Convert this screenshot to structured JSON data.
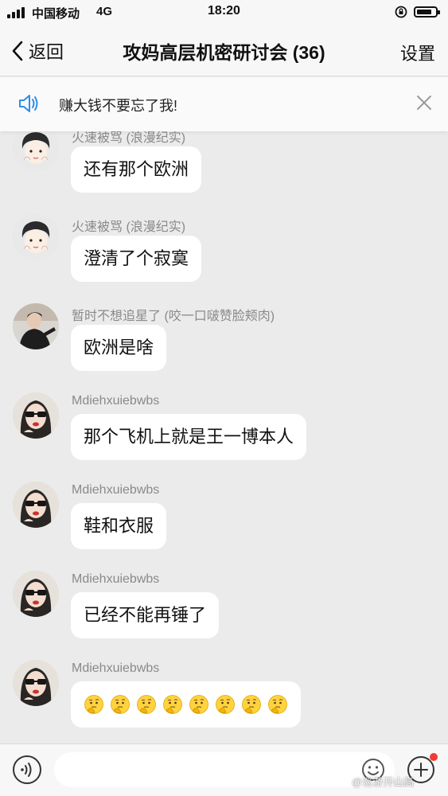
{
  "status_bar": {
    "carrier": "中国移动",
    "network": "4G",
    "time": "18:20",
    "icons": [
      "signal-icon",
      "rotation-lock-icon",
      "battery-icon"
    ],
    "battery_level": 0.8
  },
  "nav": {
    "back_label": "返回",
    "title": "攻妈高层机密研讨会 (36)",
    "settings_label": "设置"
  },
  "notice": {
    "text": "赚大钱不要忘了我!",
    "icon": "speaker-icon",
    "close_icon": "close-icon",
    "accent_color": "#2f8de8"
  },
  "messages": [
    {
      "sender": "火速被骂 (浪漫纪实)",
      "text": "还有那个欧洲",
      "avatar": "cartoon-boy-avatar"
    },
    {
      "sender": "火速被骂 (浪漫纪实)",
      "text": "澄清了个寂寞",
      "avatar": "cartoon-boy-avatar"
    },
    {
      "sender": "暂时不想追星了 (咬一口啵赞脸颊肉)",
      "text": "欧洲是啥",
      "avatar": "photo-avatar"
    },
    {
      "sender": "Mdiehxuiebwbs",
      "text": "那个飞机上就是王一博本人",
      "avatar": "sunglasses-girl-avatar"
    },
    {
      "sender": "Mdiehxuiebwbs",
      "text": "鞋和衣服",
      "avatar": "sunglasses-girl-avatar"
    },
    {
      "sender": "Mdiehxuiebwbs",
      "text": "已经不能再锤了",
      "avatar": "sunglasses-girl-avatar"
    },
    {
      "sender": "Mdiehxuiebwbs",
      "text": "",
      "emoji_count": 8,
      "emoji": "thinking-face-icon",
      "avatar": "sunglasses-girl-avatar"
    }
  ],
  "input": {
    "placeholder": "",
    "voice_icon": "voice-icon",
    "emoji_icon": "smiley-icon",
    "plus_icon": "plus-icon",
    "notification_color": "#f03c35"
  },
  "watermark": "@巡游开山高"
}
